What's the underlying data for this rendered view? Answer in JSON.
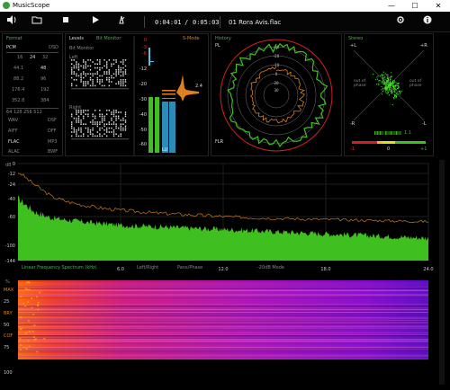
{
  "window": {
    "title": "MusicScope",
    "minimize": "—",
    "maximize": "☐",
    "close": "✕"
  },
  "toolbar": {
    "volume_icon": "speaker-icon",
    "elapsed": "0:04:01",
    "separator": "/",
    "total": "0:05:03",
    "track": "01 Rora Avis.flac"
  },
  "format": {
    "title": "Format",
    "pcm": "PCM",
    "dsd": "DSD",
    "bits": [
      "16",
      "24",
      "32"
    ],
    "rates": [
      [
        "44.1",
        "48"
      ],
      [
        "88.2",
        "96"
      ],
      [
        "176.4",
        "192"
      ],
      [
        "352.8",
        "384"
      ]
    ],
    "dsd_rates": "64 128 256 512",
    "codecs": [
      [
        "WAV",
        "DSF"
      ],
      [
        "AIFF",
        "DFF"
      ],
      [
        "FLAC",
        "MP3"
      ],
      [
        "ALAC",
        "BWF"
      ]
    ]
  },
  "levels": {
    "title": "Levels",
    "mode": "Bit Monitor",
    "sub": "Bit Monitor",
    "left": "Left",
    "right": "Right",
    "scale": [
      "0",
      "-3",
      "-6",
      "-12",
      "-20",
      "-30",
      "-40",
      "-50",
      "-60"
    ],
    "smode": "S-Mode",
    "peak_val": "2.4",
    "lu_label": "LU",
    "lu_values": {
      "left_fill": 0.73,
      "right_fill": 0.73
    }
  },
  "history": {
    "title": "History",
    "pl": "PL",
    "flr": "FLR",
    "rings": [
      "-30",
      "-20",
      "-10",
      "0",
      "20",
      "30"
    ]
  },
  "stereo": {
    "title": "Stereo",
    "plus_l": "+L",
    "plus_r": "+R",
    "minus_l": "-R",
    "minus_r": "-L",
    "out_left": "out of phase",
    "out_right": "out of phase",
    "ratio": "1:1",
    "corr_left": "-1",
    "corr_mid": "0",
    "corr_right": "+1"
  },
  "spectrum": {
    "db_label": "dB",
    "y_ticks": [
      "0",
      "-12",
      "-24",
      "-40",
      "-60",
      "-100",
      "-144"
    ],
    "x_ticks": [
      "6.0",
      "12.0",
      "18.0",
      "24.0"
    ],
    "x_label": "Linear Frequency Spectrum (kHz)",
    "opt1": "Left/Right",
    "opt2": "Pans/Phase",
    "opt3": "-20dB Mode"
  },
  "spectrogram": {
    "pct_label": "%",
    "y_ticks": [
      "MAX",
      "25",
      "BRY",
      "50",
      "COF",
      "75",
      "100"
    ]
  },
  "colors": {
    "green": "#3fc020",
    "orange": "#e08020",
    "red": "#e03030",
    "accent": "#4caf50"
  },
  "chart_data": {
    "type": "area",
    "title": "",
    "xlabel": "Linear Frequency Spectrum (kHz)",
    "ylabel": "dB",
    "xlim": [
      0,
      24
    ],
    "ylim": [
      -144,
      0
    ],
    "x": [
      0,
      1,
      2,
      3,
      4,
      5,
      6,
      8,
      10,
      12,
      14,
      16,
      18,
      20,
      22,
      24
    ],
    "series": [
      {
        "values": [
          -40,
          -55,
          -62,
          -65,
          -68,
          -70,
          -72,
          -74,
          -76,
          -78,
          -80,
          -82,
          -84,
          -86,
          -88,
          -90
        ]
      },
      {
        "values": [
          -10,
          -25,
          -38,
          -44,
          -48,
          -51,
          -53,
          -56,
          -58,
          -60,
          -62,
          -63,
          -64,
          -65,
          -66,
          -67
        ]
      }
    ]
  }
}
